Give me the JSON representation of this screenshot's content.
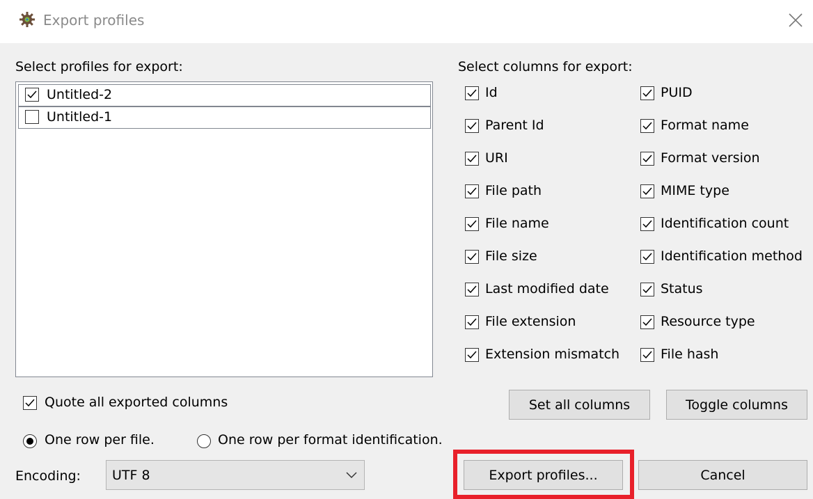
{
  "window": {
    "title": "Export profiles",
    "icon": "gear-icon",
    "close_icon": "close-icon"
  },
  "profiles": {
    "label": "Select profiles for export:",
    "items": [
      {
        "label": "Untitled-2",
        "checked": true
      },
      {
        "label": "Untitled-1",
        "checked": false
      }
    ]
  },
  "columns": {
    "label": "Select columns for export:",
    "left": [
      {
        "label": "Id",
        "checked": true
      },
      {
        "label": "Parent Id",
        "checked": true
      },
      {
        "label": "URI",
        "checked": true
      },
      {
        "label": "File path",
        "checked": true
      },
      {
        "label": "File name",
        "checked": true
      },
      {
        "label": "File size",
        "checked": true
      },
      {
        "label": "Last modified date",
        "checked": true
      },
      {
        "label": "File extension",
        "checked": true
      },
      {
        "label": "Extension mismatch",
        "checked": true
      }
    ],
    "right": [
      {
        "label": "PUID",
        "checked": true
      },
      {
        "label": "Format name",
        "checked": true
      },
      {
        "label": "Format version",
        "checked": true
      },
      {
        "label": "MIME type",
        "checked": true
      },
      {
        "label": "Identification count",
        "checked": true
      },
      {
        "label": "Identification method",
        "checked": true
      },
      {
        "label": "Status",
        "checked": true
      },
      {
        "label": "Resource type",
        "checked": true
      },
      {
        "label": "File hash",
        "checked": true
      }
    ]
  },
  "options": {
    "quote_label": "Quote all exported columns",
    "quote_checked": true,
    "row_per_file_label": "One row per file.",
    "row_per_format_label": "One row per format identification.",
    "selected_row_mode": "One row per file."
  },
  "encoding": {
    "label": "Encoding:",
    "value": "UTF 8"
  },
  "buttons": {
    "set_all": "Set all columns",
    "toggle": "Toggle columns",
    "export": "Export profiles...",
    "cancel": "Cancel"
  },
  "colors": {
    "highlight": "#e8202a",
    "background": "#f0f0f0"
  }
}
